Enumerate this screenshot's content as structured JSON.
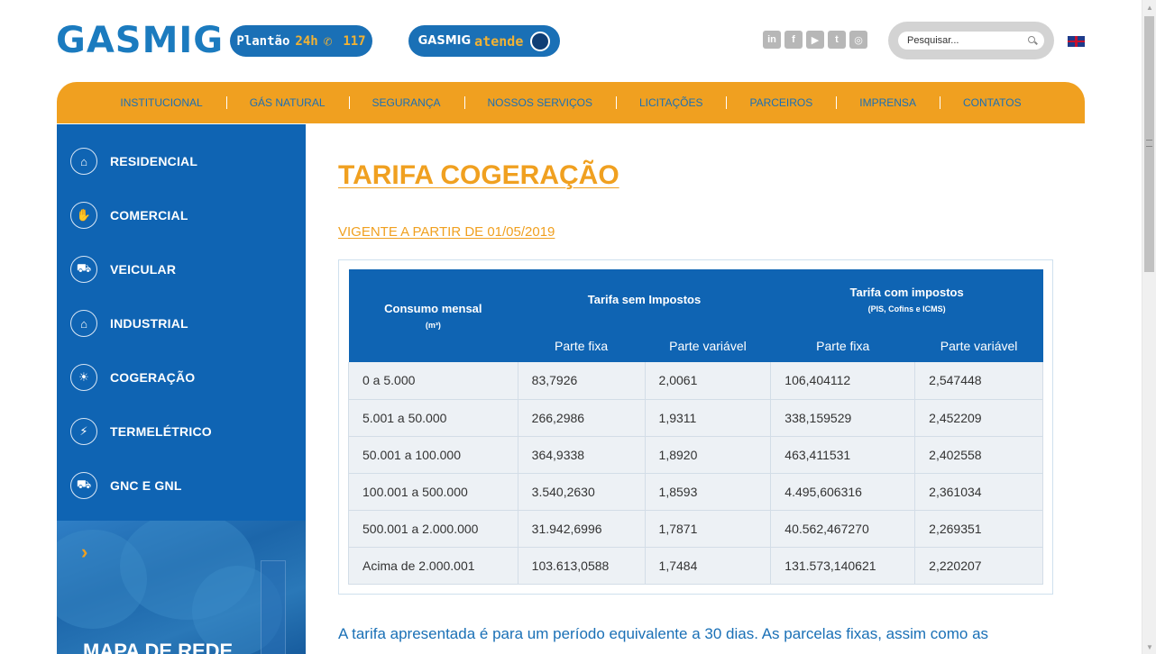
{
  "header": {
    "logo_text": "GASMIG",
    "plantao": {
      "label": "Plantão",
      "hours": "24h",
      "number": "117"
    },
    "atende": {
      "brand": "GASMIG",
      "label": "atende"
    },
    "social": [
      "in",
      "f",
      "▶",
      "t",
      "◎"
    ],
    "social_icons": [
      "linkedin-icon",
      "facebook-icon",
      "youtube-icon",
      "twitter-icon",
      "instagram-icon"
    ],
    "search": {
      "placeholder": "Pesquisar..."
    }
  },
  "nav": {
    "items": [
      "INSTITUCIONAL",
      "GÁS NATURAL",
      "SEGURANÇA",
      "NOSSOS SERVIÇOS",
      "LICITAÇÕES",
      "PARCEIROS",
      "IMPRENSA",
      "CONTATOS"
    ]
  },
  "sidebar": {
    "items": [
      {
        "label": "RESIDENCIAL",
        "icon": "house-icon",
        "glyph": "⌂"
      },
      {
        "label": "COMERCIAL",
        "icon": "handshake-icon",
        "glyph": "✋"
      },
      {
        "label": "VEICULAR",
        "icon": "truck-icon",
        "glyph": "⛟"
      },
      {
        "label": "INDUSTRIAL",
        "icon": "factory-icon",
        "glyph": "⌂"
      },
      {
        "label": "COGERAÇÃO",
        "icon": "bulb-icon",
        "glyph": "☀"
      },
      {
        "label": "TERMELÉTRICO",
        "icon": "power-plant-icon",
        "glyph": "⚡"
      },
      {
        "label": "GNC E GNL",
        "icon": "tanker-icon",
        "glyph": "⛟"
      }
    ],
    "banner": {
      "arrow": "›",
      "title": "MAPA DE REDE"
    }
  },
  "main": {
    "title": "TARIFA COGERAÇÃO",
    "subtitle": "VIGENTE A PARTIR DE 01/05/2019",
    "table": {
      "col_consumo": "Consumo mensal",
      "col_consumo_unit": "(m³)",
      "group_sem": "Tarifa sem Impostos",
      "group_com": "Tarifa com impostos",
      "group_com_note": "(PIS, Cofins e ICMS)",
      "parte_fixa": "Parte fixa",
      "parte_variavel": "Parte variável",
      "rows": [
        [
          "0 a 5.000",
          "83,7926",
          "2,0061",
          "106,404112",
          "2,547448"
        ],
        [
          "5.001 a 50.000",
          "266,2986",
          "1,9311",
          "338,159529",
          "2,452209"
        ],
        [
          "50.001 a 100.000",
          "364,9338",
          "1,8920",
          "463,411531",
          "2,402558"
        ],
        [
          "100.001 a 500.000",
          "3.540,2630",
          "1,8593",
          "4.495,606316",
          "2,361034"
        ],
        [
          "500.001 a 2.000.000",
          "31.942,6996",
          "1,7871",
          "40.562,467270",
          "2,269351"
        ],
        [
          "Acima de 2.000.001",
          "103.613,0588",
          "1,7484",
          "131.573,140621",
          "2,220207"
        ]
      ]
    },
    "note": "A tarifa apresentada é para um período equivalente a 30 dias. As parcelas fixas, assim como as"
  },
  "colors": {
    "brand_blue": "#0f64b3",
    "accent_orange": "#f0a020",
    "link_blue": "#1a70b6"
  }
}
